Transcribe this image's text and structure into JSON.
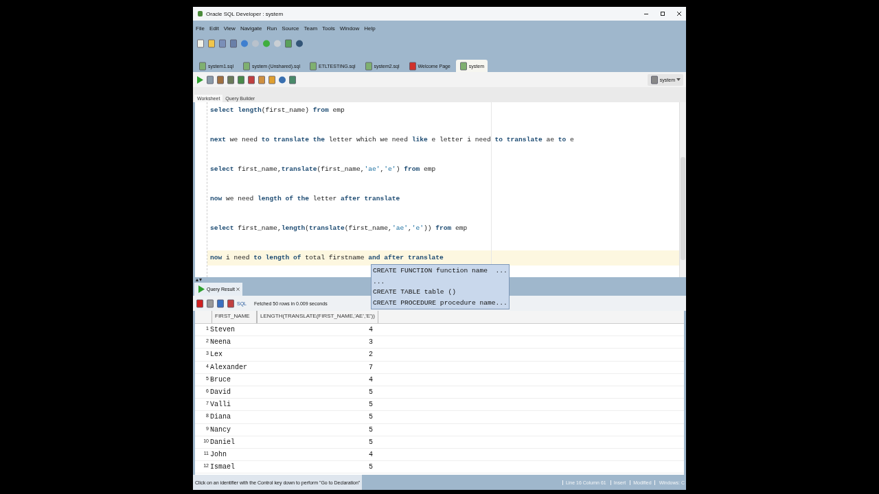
{
  "window": {
    "title": "Oracle SQL Developer : system"
  },
  "menu": [
    "File",
    "Edit",
    "View",
    "Navigate",
    "Run",
    "Source",
    "Team",
    "Tools",
    "Window",
    "Help"
  ],
  "doc_tabs": [
    {
      "label": "system1.sql",
      "selected": false
    },
    {
      "label": "system (Unshared).sql",
      "selected": false
    },
    {
      "label": "ETLTESTING.sql",
      "selected": false
    },
    {
      "label": "system2.sql",
      "selected": false
    },
    {
      "label": "Welcome Page",
      "selected": false
    },
    {
      "label": "system",
      "selected": true
    }
  ],
  "connection": "system",
  "editor_tabs": [
    {
      "label": "Worksheet",
      "selected": true
    },
    {
      "label": "Query Builder",
      "selected": false
    }
  ],
  "editor": {
    "lines": [
      {
        "current": false,
        "segments": [
          {
            "kind": "kw",
            "text": "select length"
          },
          {
            "kind": "plain",
            "text": "(first_name) "
          },
          {
            "kind": "kw",
            "text": "from"
          },
          {
            "kind": "plain",
            "text": " emp"
          }
        ]
      },
      {
        "current": false,
        "segments": [
          {
            "kind": "kw",
            "text": "next"
          },
          {
            "kind": "plain",
            "text": " we need "
          },
          {
            "kind": "kw",
            "text": "to translate the"
          },
          {
            "kind": "plain",
            "text": " letter which we need "
          },
          {
            "kind": "kw",
            "text": "like"
          },
          {
            "kind": "plain",
            "text": " e letter i need "
          },
          {
            "kind": "kw",
            "text": "to translate"
          },
          {
            "kind": "plain",
            "text": " ae "
          },
          {
            "kind": "kw",
            "text": "to"
          },
          {
            "kind": "plain",
            "text": " e"
          }
        ]
      },
      {
        "current": false,
        "segments": [
          {
            "kind": "kw",
            "text": "select"
          },
          {
            "kind": "plain",
            "text": " first_name,"
          },
          {
            "kind": "kw",
            "text": "translate"
          },
          {
            "kind": "plain",
            "text": "(first_name,"
          },
          {
            "kind": "str",
            "text": "'ae'"
          },
          {
            "kind": "plain",
            "text": ","
          },
          {
            "kind": "str",
            "text": "'e'"
          },
          {
            "kind": "plain",
            "text": ") "
          },
          {
            "kind": "kw",
            "text": "from"
          },
          {
            "kind": "plain",
            "text": " emp"
          }
        ]
      },
      {
        "current": false,
        "segments": [
          {
            "kind": "kw",
            "text": "now"
          },
          {
            "kind": "plain",
            "text": " we need "
          },
          {
            "kind": "kw",
            "text": "length of the"
          },
          {
            "kind": "plain",
            "text": " letter "
          },
          {
            "kind": "kw",
            "text": "after translate"
          }
        ]
      },
      {
        "current": false,
        "segments": [
          {
            "kind": "kw",
            "text": "select"
          },
          {
            "kind": "plain",
            "text": " first_name,"
          },
          {
            "kind": "kw",
            "text": "length"
          },
          {
            "kind": "plain",
            "text": "("
          },
          {
            "kind": "kw",
            "text": "translate"
          },
          {
            "kind": "plain",
            "text": "(first_name,"
          },
          {
            "kind": "str",
            "text": "'ae'"
          },
          {
            "kind": "plain",
            "text": ","
          },
          {
            "kind": "str",
            "text": "'e'"
          },
          {
            "kind": "plain",
            "text": ")) "
          },
          {
            "kind": "kw",
            "text": "from"
          },
          {
            "kind": "plain",
            "text": " emp"
          }
        ]
      },
      {
        "current": true,
        "segments": [
          {
            "kind": "kw",
            "text": "now"
          },
          {
            "kind": "plain",
            "text": " i need "
          },
          {
            "kind": "kw",
            "text": "to length of"
          },
          {
            "kind": "plain",
            "text": " total firstname "
          },
          {
            "kind": "kw",
            "text": "and after translate"
          }
        ]
      }
    ],
    "completion": [
      "CREATE FUNCTION function name  ...",
      "...",
      "CREATE TABLE table ()",
      "CREATE PROCEDURE procedure name..."
    ]
  },
  "result": {
    "tab": "Query Result",
    "sql_label": "SQL",
    "message": "Fetched 50 rows in 0.009 seconds",
    "columns": [
      "",
      "FIRST_NAME",
      "LENGTH(TRANSLATE(FIRST_NAME,'AE','E'))"
    ],
    "rows": [
      [
        "1",
        "Steven",
        "4"
      ],
      [
        "2",
        "Neena",
        "3"
      ],
      [
        "3",
        "Lex",
        "2"
      ],
      [
        "4",
        "Alexander",
        "7"
      ],
      [
        "5",
        "Bruce",
        "4"
      ],
      [
        "6",
        "David",
        "5"
      ],
      [
        "7",
        "Valli",
        "5"
      ],
      [
        "8",
        "Diana",
        "5"
      ],
      [
        "9",
        "Nancy",
        "5"
      ],
      [
        "10",
        "Daniel",
        "5"
      ],
      [
        "11",
        "John",
        "4"
      ],
      [
        "12",
        "Ismael",
        "5"
      ]
    ]
  },
  "status_bar": {
    "hint": "Click on an identifier with the Control key down to perform \"Go to Declaration\"",
    "position": "Line 16 Column 61",
    "mode": "Insert",
    "state": "Modified",
    "line_endings": "Windows: C"
  }
}
